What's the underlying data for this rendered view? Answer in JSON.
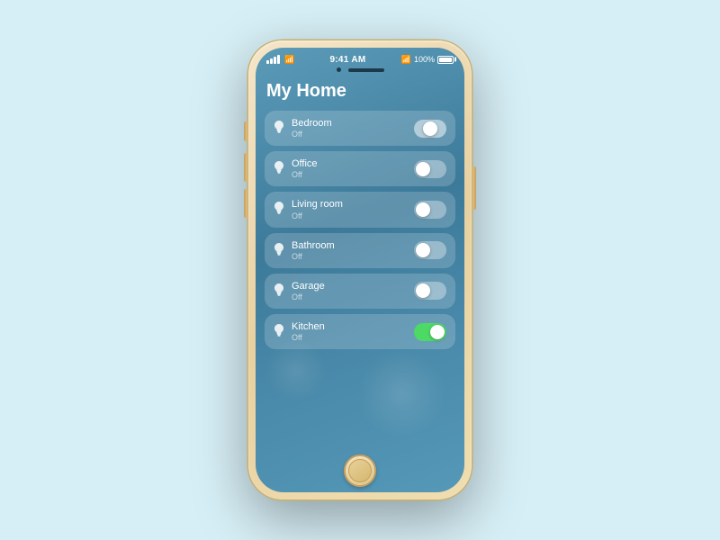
{
  "app": {
    "title": "My Home"
  },
  "status_bar": {
    "time": "9:41 AM",
    "battery_pct": "100%"
  },
  "rooms": [
    {
      "id": "bedroom",
      "name": "Bedroom",
      "status": "Off",
      "state": "clicking"
    },
    {
      "id": "office",
      "name": "Office",
      "status": "Off",
      "state": "off"
    },
    {
      "id": "livingroom",
      "name": "Living room",
      "status": "Off",
      "state": "off"
    },
    {
      "id": "bathroom",
      "name": "Bathroom",
      "status": "Off",
      "state": "off"
    },
    {
      "id": "garage",
      "name": "Garage",
      "status": "Off",
      "state": "off"
    },
    {
      "id": "kitchen",
      "name": "Kitchen",
      "status": "Off",
      "state": "on"
    }
  ]
}
